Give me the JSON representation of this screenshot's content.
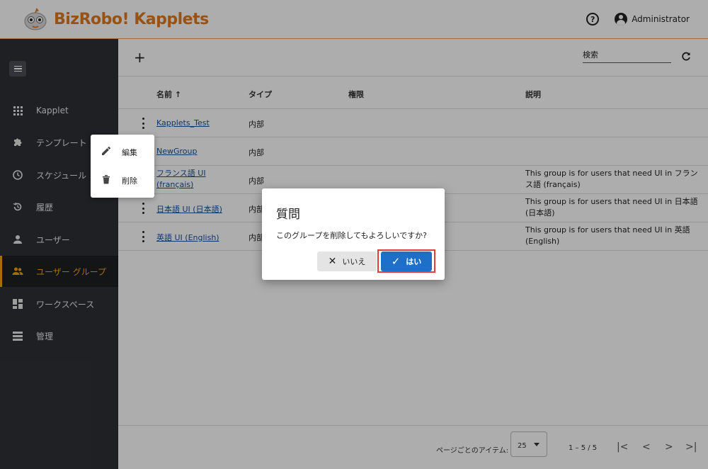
{
  "app": {
    "logo_text": "BizRobo! Kapplets"
  },
  "header": {
    "user_name": "Administrator",
    "help_icon": "help-circle-icon",
    "account_icon": "account-circle-icon"
  },
  "sidebar": {
    "items": [
      {
        "label": "Kapplet",
        "icon": "apps-grid-icon"
      },
      {
        "label": "テンプレート",
        "icon": "puzzle-icon"
      },
      {
        "label": "スケジュール",
        "icon": "clock-icon"
      },
      {
        "label": "履歴",
        "icon": "history-icon"
      },
      {
        "label": "ユーザー",
        "icon": "person-icon"
      },
      {
        "label": "ユーザー グループ",
        "icon": "group-icon",
        "active": true
      },
      {
        "label": "ワークスペース",
        "icon": "dashboard-icon"
      },
      {
        "label": "管理",
        "icon": "storage-icon"
      }
    ]
  },
  "toolbar": {
    "add_label": "+",
    "search_placeholder": "検索"
  },
  "table": {
    "headers": {
      "name": "名前 ↑",
      "type": "タイプ",
      "permission": "権限",
      "description": "説明"
    },
    "rows": [
      {
        "name": "Kapplets_Test",
        "type": "内部",
        "description": ""
      },
      {
        "name": "NewGroup",
        "type": "内部",
        "description": ""
      },
      {
        "name": "フランス語 UI (français)",
        "type": "内部",
        "description": "This group is for users that need UI in フランス語 (français)"
      },
      {
        "name": "日本語 UI (日本語)",
        "type": "内部",
        "description": "This group is for users that need UI in 日本語 (日本語)"
      },
      {
        "name": "英語 UI (English)",
        "type": "内部",
        "description": "This group is for users that need UI in 英語 (English)"
      }
    ]
  },
  "footer": {
    "per_page_label": "ページごとのアイテム:",
    "per_page_value": "25",
    "range": "1 – 5 / 5"
  },
  "context_menu": {
    "edit_label": "編集",
    "delete_label": "削除"
  },
  "dialog": {
    "title": "質問",
    "message": "このグループを削除してもよろしいですか?",
    "no_label": "いいえ",
    "yes_label": "はい"
  },
  "colors": {
    "accent": "#f0a30a",
    "brand": "#e07a1c",
    "primary_button": "#1d6fc8",
    "sidebar_bg": "#2e3036",
    "link": "#1a4f99"
  }
}
